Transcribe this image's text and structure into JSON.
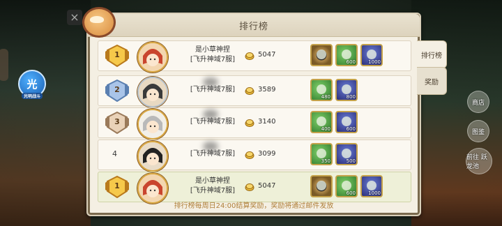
{
  "panel": {
    "title": "排行榜"
  },
  "left_button": {
    "glyph": "光",
    "label": "光明战斗"
  },
  "tabs": [
    {
      "label": "排行榜",
      "active": true
    },
    {
      "label": "奖励",
      "active": false
    }
  ],
  "right_side": [
    "商店",
    "图鉴",
    "前往 跃龙池"
  ],
  "rows": [
    {
      "rank": "1",
      "badge": "gold",
      "name_line1": "是小草神捏",
      "name_line2": "[飞升神域7服]",
      "score": "5047",
      "rewards": [
        {
          "type": "ring",
          "qty": ""
        },
        {
          "type": "green",
          "qty": "600"
        },
        {
          "type": "blue",
          "qty": "1000"
        }
      ]
    },
    {
      "rank": "2",
      "badge": "silver",
      "name_line1": "",
      "name_line2": "[飞升神域7服]",
      "score": "3589",
      "rewards": [
        {
          "type": "green",
          "qty": "480"
        },
        {
          "type": "blue",
          "qty": "800"
        }
      ]
    },
    {
      "rank": "3",
      "badge": "bronze",
      "name_line1": "",
      "name_line2": "[飞升神域7服]",
      "score": "3140",
      "rewards": [
        {
          "type": "green",
          "qty": "400"
        },
        {
          "type": "blue",
          "qty": "600"
        }
      ]
    },
    {
      "rank": "4",
      "badge": "none",
      "name_line1": "",
      "name_line2": "[飞升神域7服]",
      "score": "3099",
      "rewards": [
        {
          "type": "green",
          "qty": "350"
        },
        {
          "type": "blue",
          "qty": "500"
        }
      ]
    },
    {
      "rank": "1",
      "badge": "gold",
      "name_line1": "是小草神捏",
      "name_line2": "[飞升神域7服]",
      "score": "5047",
      "rewards": [
        {
          "type": "ring",
          "qty": ""
        },
        {
          "type": "green",
          "qty": "600"
        },
        {
          "type": "blue",
          "qty": "1000"
        }
      ]
    }
  ],
  "footer_note": "排行榜每周日24:00结算奖励，奖励将通过邮件发放",
  "colors": {
    "accent_gold": "#d9a740",
    "footer_text": "#b0803a",
    "my_row_bg": "#eef0d8"
  }
}
